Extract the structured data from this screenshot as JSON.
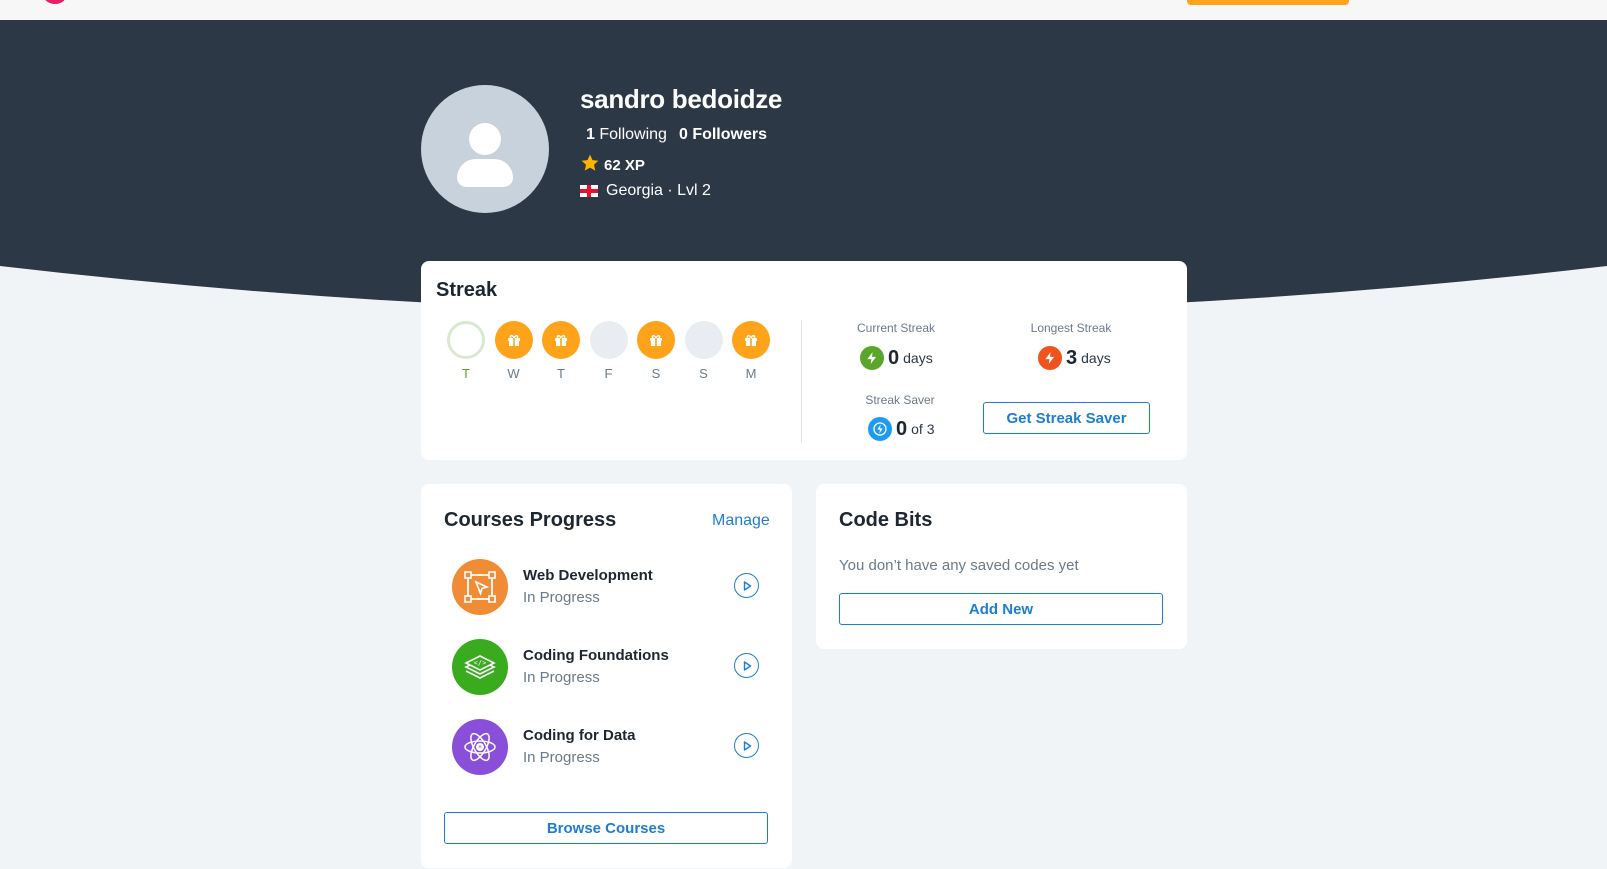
{
  "colors": {
    "hero_bg": "#2d3846",
    "accent_blue": "#1d7ed1",
    "streak_orange": "#ffa31a",
    "current_green": "#5aa62b",
    "longest_red": "#f0541e",
    "saver_blue": "#1d9bf0"
  },
  "profile": {
    "name": "sandro bedoidze",
    "following_count": "1",
    "following_label": "Following",
    "followers_count": "0",
    "followers_label": "Followers",
    "xp": "62 XP",
    "country_level": "Georgia · Lvl 2"
  },
  "streak": {
    "title": "Streak",
    "days": [
      {
        "label": "T",
        "state": "today"
      },
      {
        "label": "W",
        "state": "gift"
      },
      {
        "label": "T",
        "state": "gift"
      },
      {
        "label": "F",
        "state": "empty"
      },
      {
        "label": "S",
        "state": "gift"
      },
      {
        "label": "S",
        "state": "empty"
      },
      {
        "label": "M",
        "state": "gift"
      }
    ],
    "current_label": "Current Streak",
    "current_value": "0",
    "current_unit": "days",
    "longest_label": "Longest Streak",
    "longest_value": "3",
    "longest_unit": "days",
    "saver_label": "Streak Saver",
    "saver_value": "0",
    "saver_unit": "of 3",
    "get_saver_button": "Get Streak Saver"
  },
  "courses": {
    "title": "Courses Progress",
    "manage_label": "Manage",
    "items": [
      {
        "name": "Web Development",
        "status": "In Progress",
        "icon": "web-development-icon",
        "color": "#f08c36"
      },
      {
        "name": "Coding Foundations",
        "status": "In Progress",
        "icon": "coding-foundations-icon",
        "color": "#3aaa1f"
      },
      {
        "name": "Coding for Data",
        "status": "In Progress",
        "icon": "coding-for-data-icon",
        "color": "#8a4fd8"
      }
    ],
    "browse_button": "Browse Courses"
  },
  "codebits": {
    "title": "Code Bits",
    "empty_text": "You don’t have any saved codes yet",
    "add_button": "Add New"
  }
}
